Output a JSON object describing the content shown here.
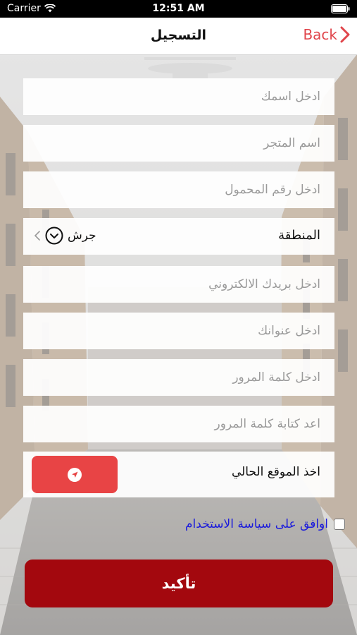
{
  "status_bar": {
    "carrier": "Carrier",
    "time": "12:51 AM"
  },
  "nav": {
    "title": "التسجيل",
    "back_label": "Back"
  },
  "form": {
    "name_placeholder": "ادخل اسمك",
    "store_placeholder": "اسم المتجر",
    "mobile_placeholder": "ادخل رقم المحمول",
    "region_label": "المنطقة",
    "region_value": "جرش",
    "email_placeholder": "ادخل بريدك الالكتروني",
    "address_placeholder": "ادخل عنوانك",
    "password_placeholder": "ادخل كلمة المرور",
    "confirm_password_placeholder": "اعد كتابة كلمة المرور",
    "location_label": "اخذ الموقع الحالي",
    "agree_label": "اوافق على سياسة الاستخدام",
    "agree_checked": false,
    "submit_label": "تأكيد"
  },
  "colors": {
    "accent_red": "#e0454b",
    "location_button": "#e84445",
    "confirm_button": "#a3080e",
    "link_blue": "#1a1adc"
  },
  "icons": {
    "wifi": "wifi-icon",
    "battery": "battery-icon",
    "back": "chevron-right-icon",
    "region_chevron": "chevron-left-icon",
    "region_dropdown": "circle-chevron-down-icon",
    "location": "navigation-arrow-icon"
  }
}
